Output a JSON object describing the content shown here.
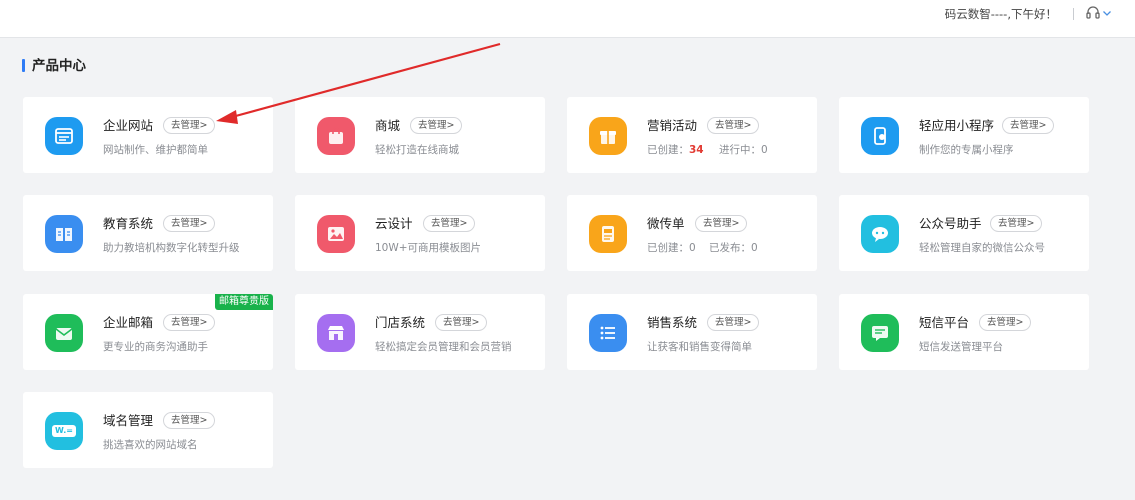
{
  "header": {
    "greeting": "码云数智----,下午好！"
  },
  "section": {
    "title": "产品中心"
  },
  "manage_label": "去管理>",
  "colors": {
    "accent": "#2f7cf6",
    "badge_green": "#19b24b",
    "highlight_red": "#e23b33",
    "arrow_red": "#e02a2a"
  },
  "cards": [
    {
      "name": "企业网站",
      "desc": "网站制作、维护都简单",
      "icon": "website-icon",
      "color": "#1e9bf0"
    },
    {
      "name": "商城",
      "desc": "轻松打造在线商城",
      "icon": "shopping-bag-icon",
      "color": "#f0596b"
    },
    {
      "name": "营销活动",
      "desc_created_label": "已创建：",
      "desc_created_value": "34",
      "desc_ongoing_label": "进行中：0",
      "icon": "gift-icon",
      "color": "#f9a51a"
    },
    {
      "name": "轻应用小程序",
      "desc": "制作您的专属小程序",
      "icon": "mini-program-icon",
      "color": "#1e9bf0"
    },
    {
      "name": "教育系统",
      "desc": "助力教培机构数字化转型升级",
      "icon": "book-icon",
      "color": "#3a8ef0"
    },
    {
      "name": "云设计",
      "desc": "10W+可商用模板图片",
      "icon": "image-icon",
      "color": "#f0596b"
    },
    {
      "name": "微传单",
      "desc": "已创建：0    已发布：0",
      "icon": "flyer-icon",
      "color": "#f9a51a"
    },
    {
      "name": "公众号助手",
      "desc": "轻松管理自家的微信公众号",
      "icon": "wechat-icon",
      "color": "#22bfe0"
    },
    {
      "name": "企业邮箱",
      "desc": "更专业的商务沟通助手",
      "badge": "邮箱尊贵版",
      "icon": "mail-icon",
      "color": "#1fbd5a"
    },
    {
      "name": "门店系统",
      "desc": "轻松搞定会员管理和会员营销",
      "icon": "store-icon",
      "color": "#a56ef0"
    },
    {
      "name": "销售系统",
      "desc": "让获客和销售变得简单",
      "icon": "list-icon",
      "color": "#3a8ef0"
    },
    {
      "name": "短信平台",
      "desc": "短信发送管理平台",
      "icon": "sms-icon",
      "color": "#1fbd5a"
    },
    {
      "name": "域名管理",
      "desc": "挑选喜欢的网站域名",
      "icon": "domain-icon",
      "icon_text": "W.=",
      "color": "#22bfe0"
    }
  ]
}
